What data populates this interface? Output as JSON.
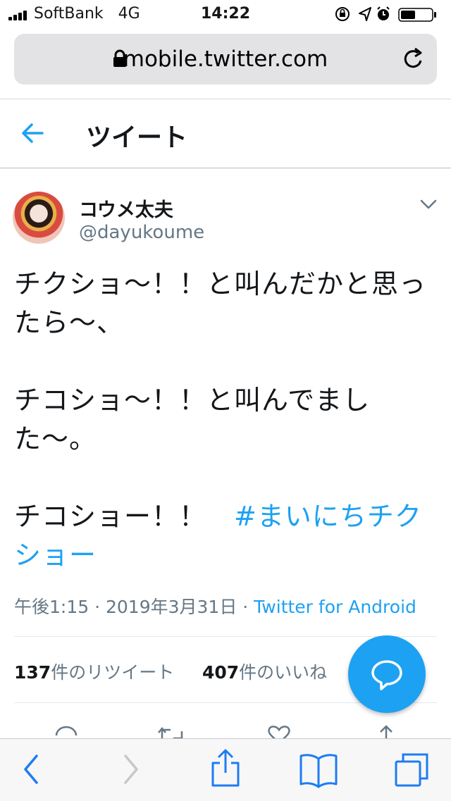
{
  "status_bar": {
    "carrier": "SoftBank",
    "network": "4G",
    "time": "14:22"
  },
  "browser": {
    "url": "mobile.twitter.com"
  },
  "header": {
    "title": "ツイート"
  },
  "tweet": {
    "display_name": "コウメ太夫",
    "handle": "@dayukoume",
    "line1": "チクショ〜！！と叫んだかと思ったら〜、",
    "line2": "チコショ〜！！と叫んでました〜。",
    "line3": "チコショー！！　",
    "hashtag": "#まいにちチクショー",
    "timestamp": "午後1:15 · 2019年3月31日 · ",
    "client": "Twitter for Android"
  },
  "stats": {
    "retweet_count": "137",
    "retweet_label": "件のリツイート",
    "like_count": "407",
    "like_label": "件のいいね"
  },
  "colors": {
    "accent": "#1da1f2",
    "secondary_text": "#657786"
  }
}
